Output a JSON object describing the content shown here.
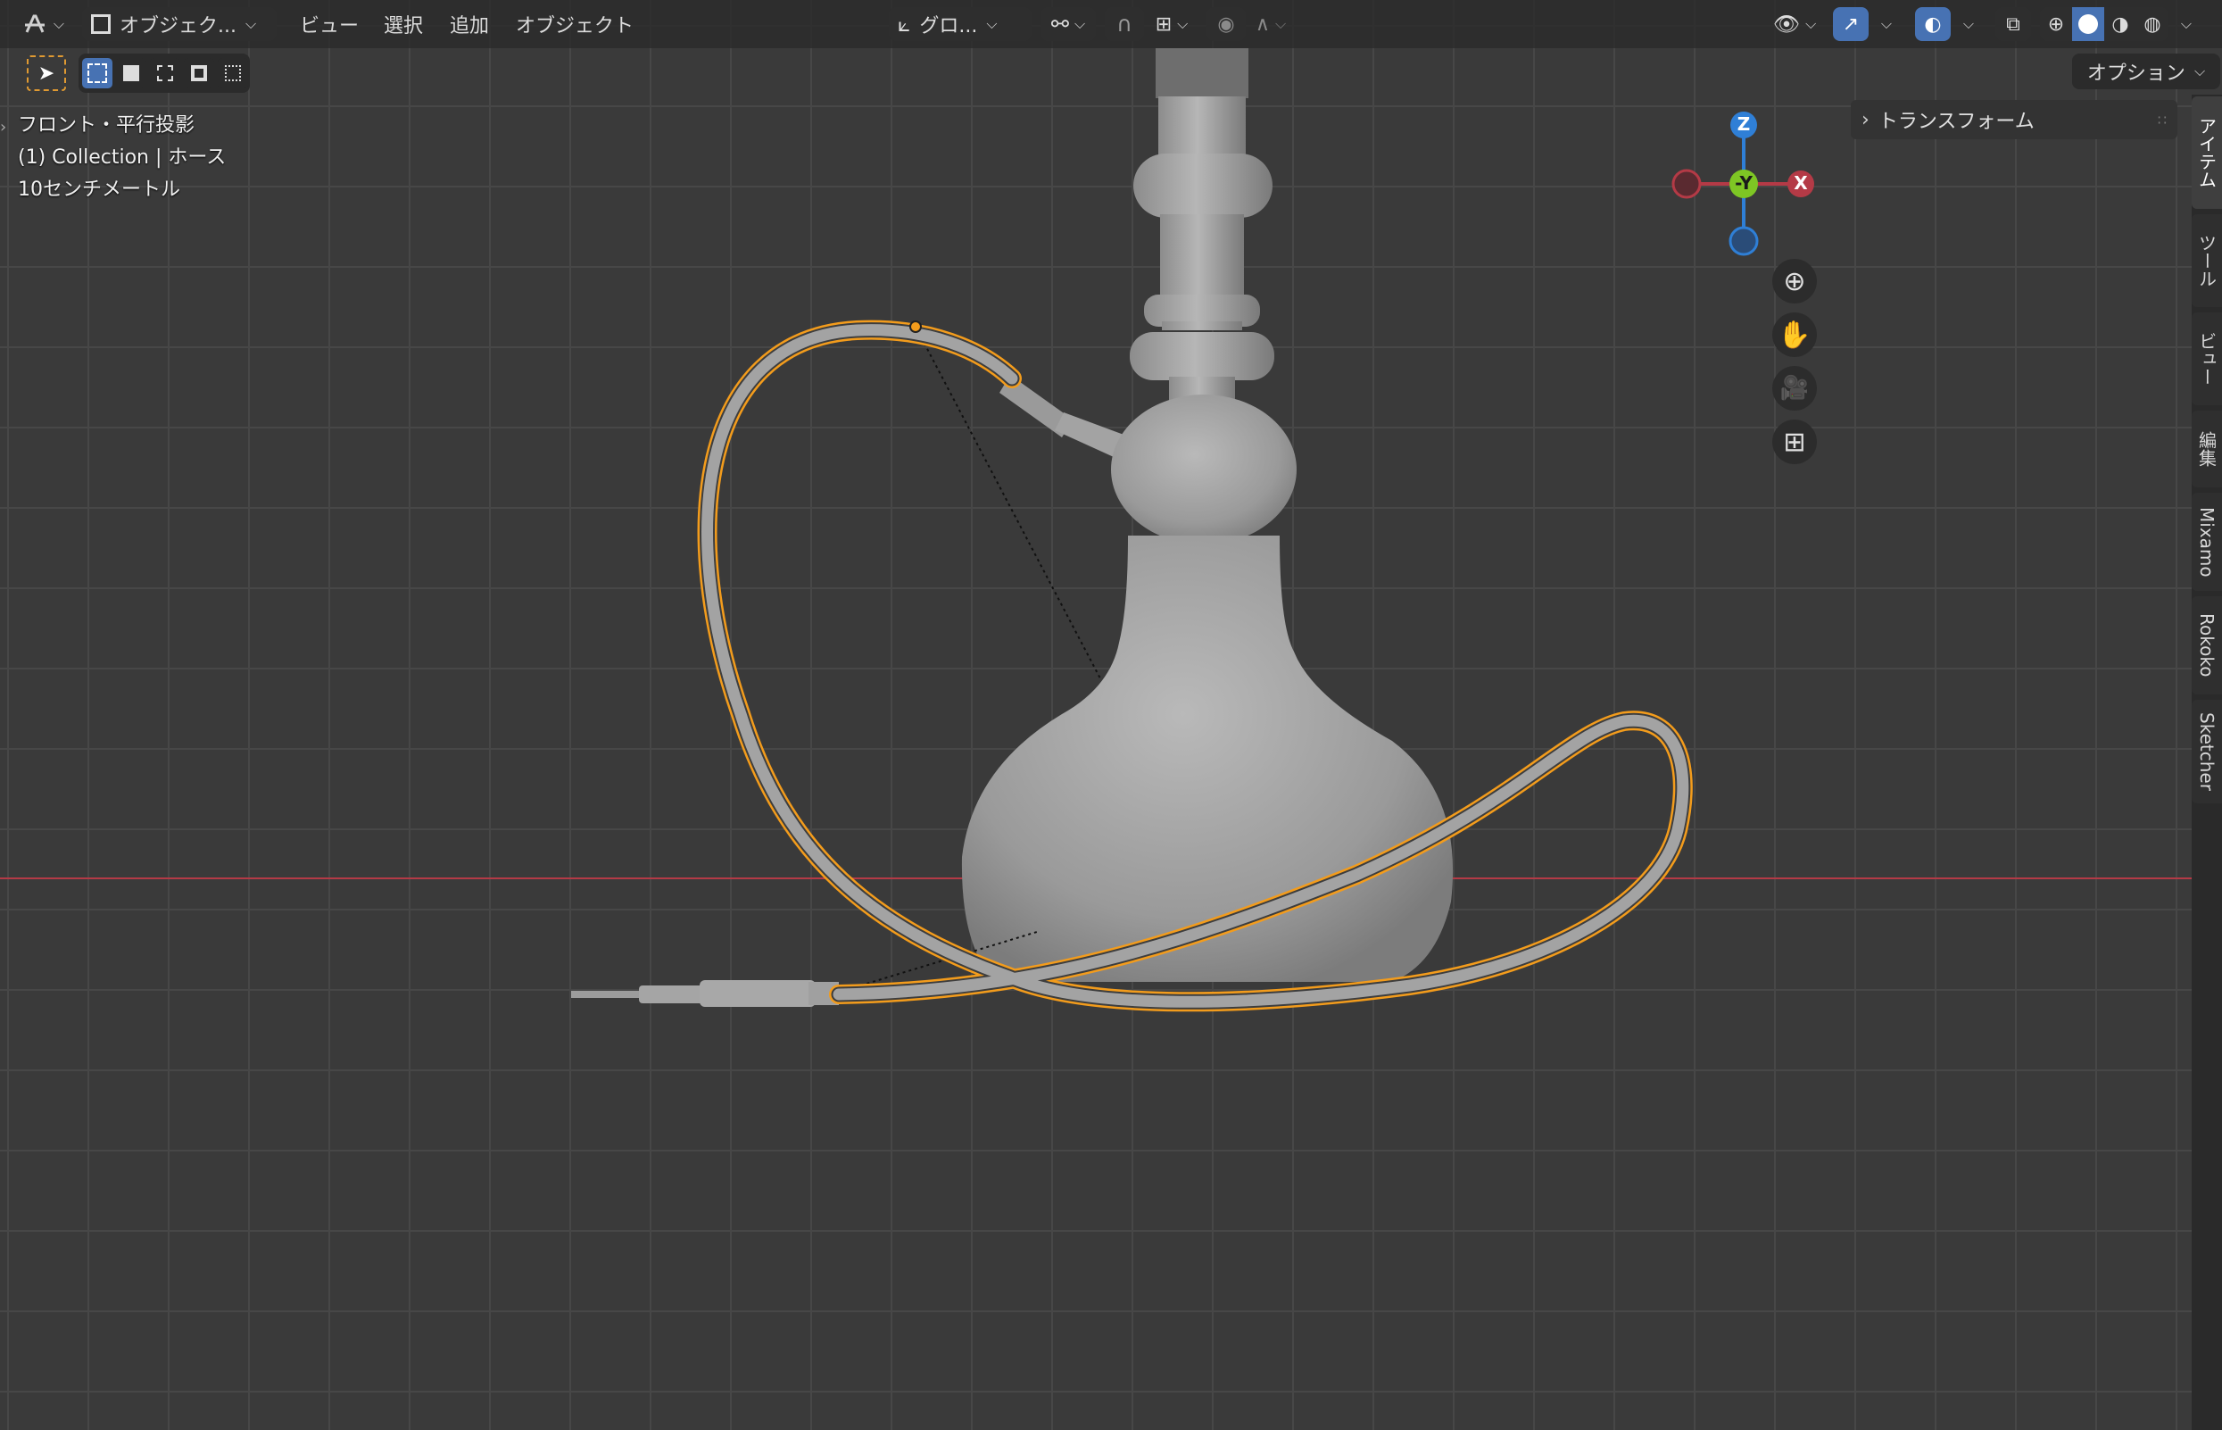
{
  "header": {
    "mode_label": "オブジェク...",
    "menu": [
      "ビュー",
      "選択",
      "追加",
      "オブジェクト"
    ],
    "transform_orientation": "グロ...",
    "options_label": "オプション"
  },
  "overlay": {
    "view_name": "フロント・平行投影",
    "collection": "(1) Collection | ホース",
    "scale": "10センチメートル"
  },
  "gizmo": {
    "z": "Z",
    "y": "-Y",
    "x": "X"
  },
  "n_panel": {
    "transform_label": "トランスフォーム",
    "tabs": [
      "アイテム",
      "ツール",
      "ビュー",
      "編集",
      "Mixamo",
      "Rokoko",
      "Sketcher"
    ],
    "active_tab": "アイテム"
  },
  "colors": {
    "selection": "#f39c1c",
    "x_axis": "#b43a46",
    "y_axis": "#7ec624",
    "z_axis": "#2f7fd6",
    "accent": "#4772b3"
  }
}
